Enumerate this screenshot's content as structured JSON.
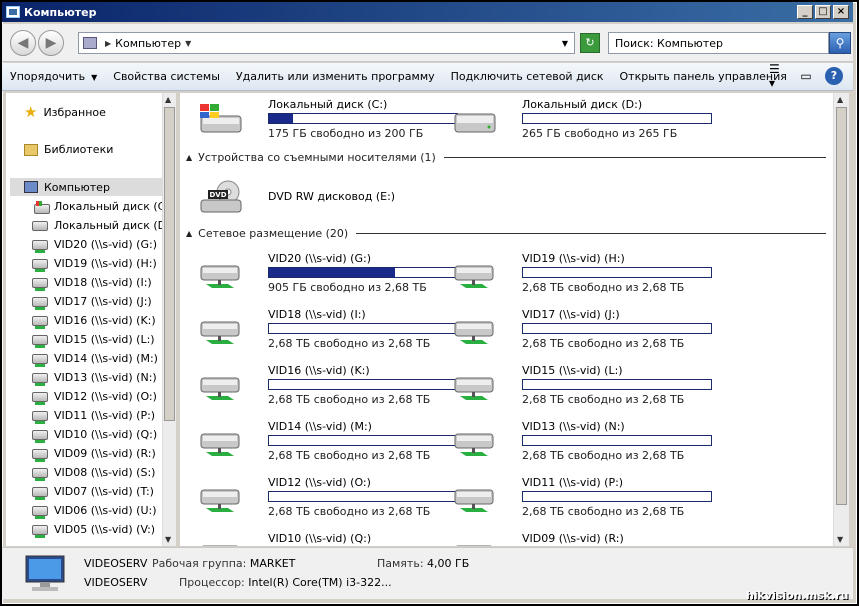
{
  "window": {
    "title": "Компьютер"
  },
  "address": {
    "path": "Компьютер",
    "search_placeholder": "Поиск: Компьютер"
  },
  "toolbar": {
    "items": [
      "Упорядочить",
      "Свойства системы",
      "Удалить или изменить программу",
      "Подключить сетевой диск",
      "Открыть панель управления"
    ]
  },
  "nav": {
    "favorites": "Избранное",
    "libraries": "Библиотеки",
    "computer": "Компьютер",
    "items": [
      "Локальный диск (C:)",
      "Локальный диск (D:)",
      "VID20 (\\\\s-vid) (G:)",
      "VID19 (\\\\s-vid) (H:)",
      "VID18 (\\\\s-vid) (I:)",
      "VID17 (\\\\s-vid) (J:)",
      "VID16 (\\\\s-vid) (K:)",
      "VID15 (\\\\s-vid) (L:)",
      "VID14 (\\\\s-vid) (M:)",
      "VID13 (\\\\s-vid) (N:)",
      "VID12 (\\\\s-vid) (O:)",
      "VID11 (\\\\s-vid) (P:)",
      "VID10 (\\\\s-vid) (Q:)",
      "VID09 (\\\\s-vid) (R:)",
      "VID08 (\\\\s-vid) (S:)",
      "VID07 (\\\\s-vid) (T:)",
      "VID06 (\\\\s-vid) (U:)",
      "VID05 (\\\\s-vid) (V:)"
    ]
  },
  "content": {
    "local": [
      {
        "name": "Локальный диск (C:)",
        "info": "175 ГБ свободно из 200 ГБ",
        "used": 0.125
      },
      {
        "name": "Локальный диск (D:)",
        "info": "265 ГБ свободно из 265 ГБ",
        "used": 0.0
      }
    ],
    "removable_header": "Устройства со съемными носителями (1)",
    "dvd": {
      "name": "DVD RW дисковод (E:)"
    },
    "network_header": "Сетевое размещение (20)",
    "network": [
      {
        "name": "VID20 (\\\\s-vid) (G:)",
        "info": "905 ГБ свободно из 2,68 ТБ",
        "used": 0.67
      },
      {
        "name": "VID19 (\\\\s-vid) (H:)",
        "info": "2,68 ТБ свободно из 2,68 ТБ",
        "used": 0.0
      },
      {
        "name": "VID18 (\\\\s-vid) (I:)",
        "info": "2,68 ТБ свободно из 2,68 ТБ",
        "used": 0.0
      },
      {
        "name": "VID17 (\\\\s-vid) (J:)",
        "info": "2,68 ТБ свободно из 2,68 ТБ",
        "used": 0.0
      },
      {
        "name": "VID16 (\\\\s-vid) (K:)",
        "info": "2,68 ТБ свободно из 2,68 ТБ",
        "used": 0.0
      },
      {
        "name": "VID15 (\\\\s-vid) (L:)",
        "info": "2,68 ТБ свободно из 2,68 ТБ",
        "used": 0.0
      },
      {
        "name": "VID14 (\\\\s-vid) (M:)",
        "info": "2,68 ТБ свободно из 2,68 ТБ",
        "used": 0.0
      },
      {
        "name": "VID13 (\\\\s-vid) (N:)",
        "info": "2,68 ТБ свободно из 2,68 ТБ",
        "used": 0.0
      },
      {
        "name": "VID12 (\\\\s-vid) (O:)",
        "info": "2,68 ТБ свободно из 2,68 ТБ",
        "used": 0.0
      },
      {
        "name": "VID11 (\\\\s-vid) (P:)",
        "info": "2,68 ТБ свободно из 2,68 ТБ",
        "used": 0.0
      },
      {
        "name": "VID10 (\\\\s-vid) (Q:)",
        "info": "",
        "used": 0.0
      },
      {
        "name": "VID09 (\\\\s-vid) (R:)",
        "info": "",
        "used": 0.0
      }
    ]
  },
  "status": {
    "name": "VIDEOSERV",
    "name2": "VIDEOSERV",
    "workgroup_label": "Рабочая группа:",
    "workgroup": "MARKET",
    "memory_label": "Память:",
    "memory": "4,00 ГБ",
    "cpu_label": "Процессор:",
    "cpu": "Intel(R) Core(TM) i3-322..."
  },
  "watermark": "hikvision.msk.ru"
}
